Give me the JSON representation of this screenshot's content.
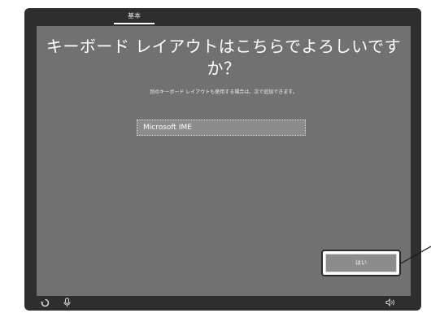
{
  "tab": {
    "label": "基本"
  },
  "main": {
    "heading": "キーボード レイアウトはこちらでよろしいですか？",
    "subtext": "別のキーボード レイアウトも使用する場合は、次で追加できます。",
    "selected_layout": "Microsoft IME",
    "yes_button": "はい"
  },
  "icons": {
    "ease_of_access": "ease-of-access-icon",
    "microphone": "microphone-icon",
    "volume": "volume-icon"
  },
  "colors": {
    "panel": "#717171",
    "frame": "#2e2e2e",
    "button": "#8c8c8c"
  }
}
